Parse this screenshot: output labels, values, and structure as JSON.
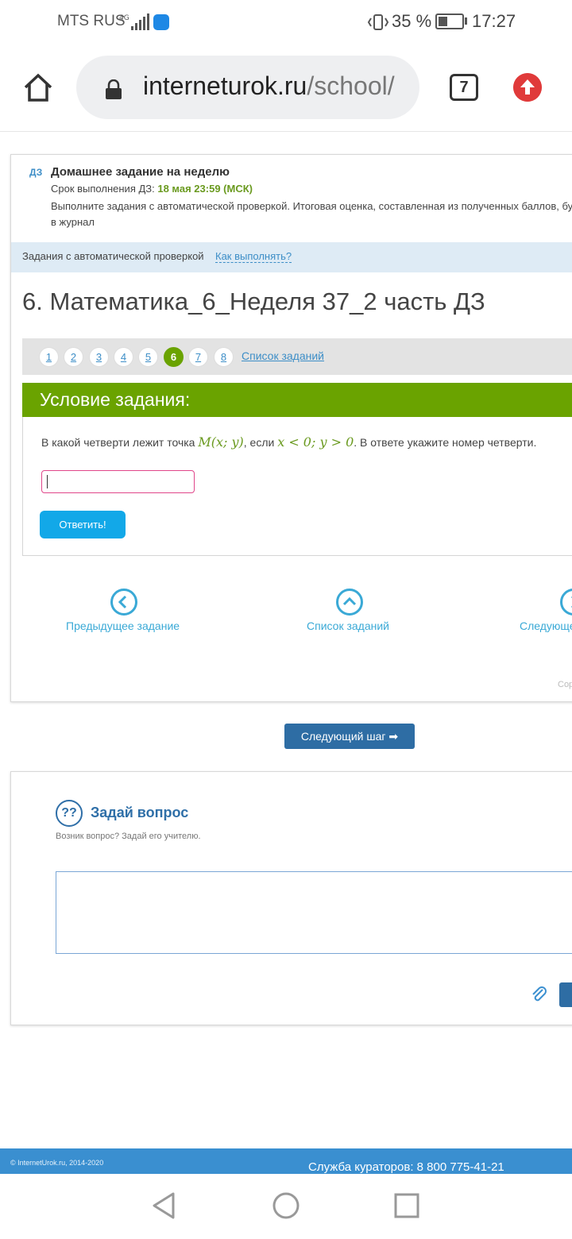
{
  "status_bar": {
    "carrier": "MTS RUS",
    "network": "4G",
    "battery": "35 %",
    "time": "17:27"
  },
  "browser": {
    "url_domain": "interneturok.ru",
    "url_path": "/school/",
    "tab_count": "7"
  },
  "homework": {
    "badge": "ДЗ",
    "title": "Домашнее задание на неделю",
    "deadline_label": "Срок выполнения ДЗ: ",
    "deadline_value": "18 мая 23:59 (МСК)",
    "description": "Выполните задания с автоматической проверкой. Итоговая оценка, составленная из полученных баллов, бу",
    "description_line2": "в журнал"
  },
  "auto_check": {
    "label": "Задания с автоматической проверкой",
    "how_link": "Как выполнять?"
  },
  "page_title": "6. Математика_6_Неделя 37_2 часть ДЗ",
  "pager": {
    "pages": [
      "1",
      "2",
      "3",
      "4",
      "5",
      "6",
      "7",
      "8"
    ],
    "active_index": 5,
    "task_list_link": "Список заданий"
  },
  "condition": {
    "header": "Условие задания:",
    "q_prefix": "В какой четверти лежит точка ",
    "q_point": "M(x; y)",
    "q_mid": ", если ",
    "q_cond": "x < 0; y > 0",
    "q_suffix": ". В ответе укажите номер четверти.",
    "answer_value": "",
    "submit_label": "Ответить!"
  },
  "task_nav": {
    "prev_label": "Предыдущее задание",
    "list_label": "Список заданий",
    "next_label": "Следующе",
    "copyright_cut": "Сор"
  },
  "next_step_label": "Следующий шаг",
  "ask": {
    "icon_text": "??",
    "title": "Задай вопрос",
    "subtitle": "Возник вопрос? Задай его учителю.",
    "textarea_value": ""
  },
  "footer": {
    "copyright": "© InternetUrok.ru, 2014-2020",
    "phone": "Служба кураторов: 8 800 775-41-21"
  },
  "colors": {
    "accent_green": "#6aa300",
    "link_blue": "#3d8ec7",
    "button_cyan": "#12a8e8",
    "footer_blue": "#3a8fd0"
  }
}
